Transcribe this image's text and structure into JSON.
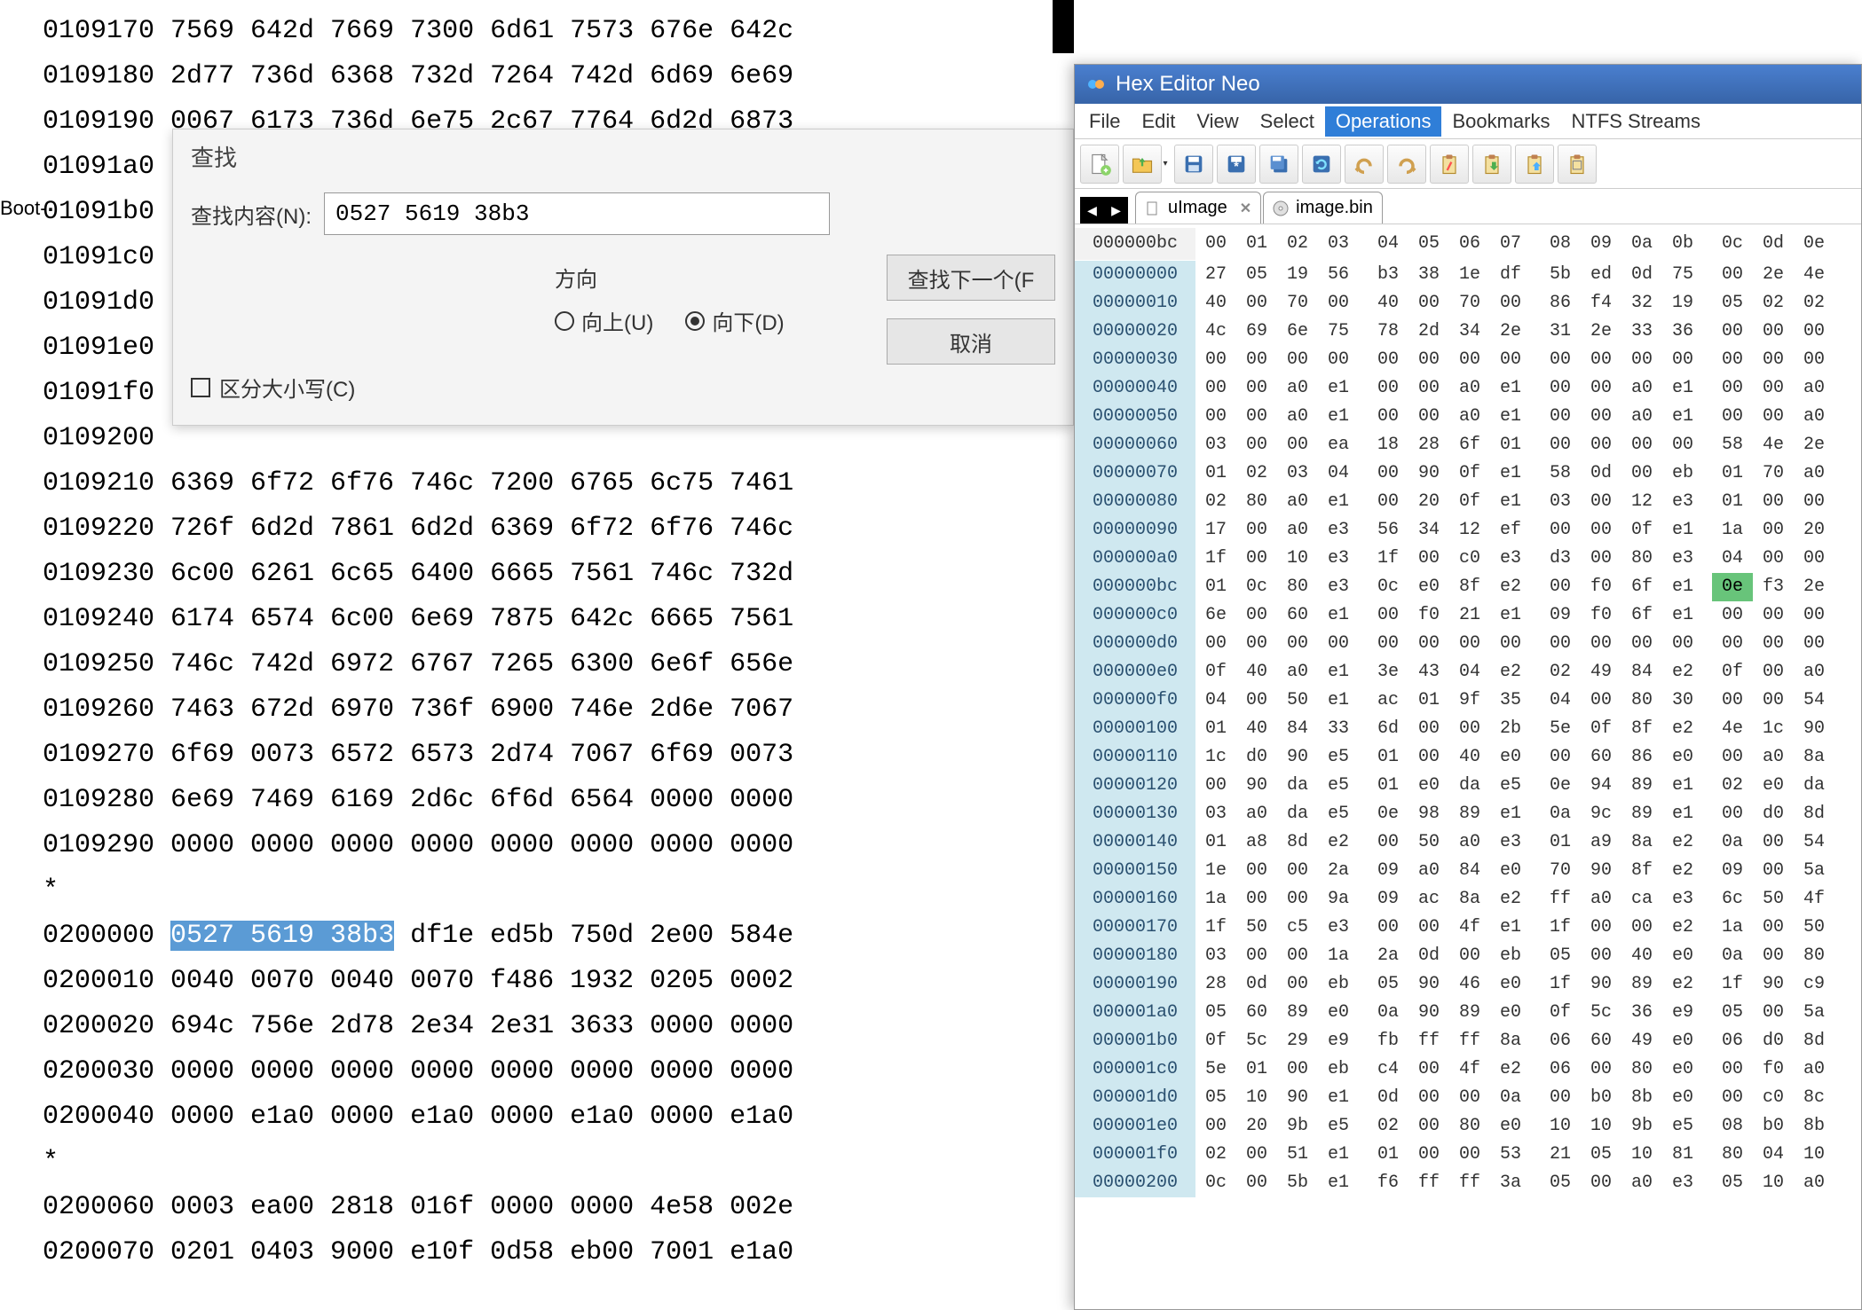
{
  "left": {
    "boot_label": "Boot-",
    "lines": [
      "0109170 7569 642d 7669 7300 6d61 7573 676e 642c",
      "0109180 2d77 736d 6368 732d 7264 742d 6d69 6e69",
      "0109190 0067 6173 736d 6e75 2c67 7764 6d2d 6873",
      "01091a0",
      "01091b0",
      "01091c0",
      "01091d0",
      "01091e0",
      "01091f0",
      "0109200",
      "0109210 6369 6f72 6f76 746c 7200 6765 6c75 7461",
      "0109220 726f 6d2d 7861 6d2d 6369 6f72 6f76 746c",
      "0109230 6c00 6261 6c65 6400 6665 7561 746c 732d",
      "0109240 6174 6574 6c00 6e69 7875 642c 6665 7561",
      "0109250 746c 742d 6972 6767 7265 6300 6e6f 656e",
      "0109260 7463 672d 6970 736f 6900 746e 2d6e 7067",
      "0109270 6f69 0073 6572 6573 2d74 7067 6f69 0073",
      "0109280 6e69 7469 6169 2d6c 6f6d 6564 0000 0000",
      "0109290 0000 0000 0000 0000 0000 0000 0000 0000",
      "*",
      "0200000 {HL}0527 5619 38b3{/HL} df1e ed5b 750d 2e00 584e",
      "0200010 0040 0070 0040 0070 f486 1932 0205 0002",
      "0200020 694c 756e 2d78 2e34 2e31 3633 0000 0000",
      "0200030 0000 0000 0000 0000 0000 0000 0000 0000",
      "0200040 0000 e1a0 0000 e1a0 0000 e1a0 0000 e1a0",
      "*",
      "0200060 0003 ea00 2818 016f 0000 0000 4e58 002e",
      "0200070 0201 0403 9000 e10f 0d58 eb00 7001 e1a0"
    ]
  },
  "find_dialog": {
    "title": "查找",
    "label": "查找内容(N):",
    "value": "0527 5619 38b3",
    "direction_label": "方向",
    "radio_up": "向上(U)",
    "radio_down": "向下(D)",
    "case_label": "区分大小写(C)",
    "btn_next": "查找下一个(F",
    "btn_cancel": "取消"
  },
  "hex_editor": {
    "title": "Hex Editor Neo",
    "menuitems": [
      "File",
      "Edit",
      "View",
      "Select",
      "Operations",
      "Bookmarks",
      "NTFS Streams"
    ],
    "active_menu": 4,
    "tabs": [
      {
        "label": "uImage",
        "closable": true
      },
      {
        "label": "image.bin",
        "closable": false
      }
    ],
    "header_addr": "000000bc",
    "columns": [
      "00",
      "01",
      "02",
      "03",
      "04",
      "05",
      "06",
      "07",
      "08",
      "09",
      "0a",
      "0b",
      "0c",
      "0d",
      "0e"
    ],
    "rows": [
      {
        "addr": "00000000",
        "b": [
          "27",
          "05",
          "19",
          "56",
          "b3",
          "38",
          "1e",
          "df",
          "5b",
          "ed",
          "0d",
          "75",
          "00",
          "2e",
          "4e"
        ]
      },
      {
        "addr": "00000010",
        "b": [
          "40",
          "00",
          "70",
          "00",
          "40",
          "00",
          "70",
          "00",
          "86",
          "f4",
          "32",
          "19",
          "05",
          "02",
          "02"
        ]
      },
      {
        "addr": "00000020",
        "b": [
          "4c",
          "69",
          "6e",
          "75",
          "78",
          "2d",
          "34",
          "2e",
          "31",
          "2e",
          "33",
          "36",
          "00",
          "00",
          "00"
        ]
      },
      {
        "addr": "00000030",
        "b": [
          "00",
          "00",
          "00",
          "00",
          "00",
          "00",
          "00",
          "00",
          "00",
          "00",
          "00",
          "00",
          "00",
          "00",
          "00"
        ]
      },
      {
        "addr": "00000040",
        "b": [
          "00",
          "00",
          "a0",
          "e1",
          "00",
          "00",
          "a0",
          "e1",
          "00",
          "00",
          "a0",
          "e1",
          "00",
          "00",
          "a0"
        ]
      },
      {
        "addr": "00000050",
        "b": [
          "00",
          "00",
          "a0",
          "e1",
          "00",
          "00",
          "a0",
          "e1",
          "00",
          "00",
          "a0",
          "e1",
          "00",
          "00",
          "a0"
        ]
      },
      {
        "addr": "00000060",
        "b": [
          "03",
          "00",
          "00",
          "ea",
          "18",
          "28",
          "6f",
          "01",
          "00",
          "00",
          "00",
          "00",
          "58",
          "4e",
          "2e"
        ]
      },
      {
        "addr": "00000070",
        "b": [
          "01",
          "02",
          "03",
          "04",
          "00",
          "90",
          "0f",
          "e1",
          "58",
          "0d",
          "00",
          "eb",
          "01",
          "70",
          "a0"
        ]
      },
      {
        "addr": "00000080",
        "b": [
          "02",
          "80",
          "a0",
          "e1",
          "00",
          "20",
          "0f",
          "e1",
          "03",
          "00",
          "12",
          "e3",
          "01",
          "00",
          "00"
        ]
      },
      {
        "addr": "00000090",
        "b": [
          "17",
          "00",
          "a0",
          "e3",
          "56",
          "34",
          "12",
          "ef",
          "00",
          "00",
          "0f",
          "e1",
          "1a",
          "00",
          "20"
        ]
      },
      {
        "addr": "000000a0",
        "b": [
          "1f",
          "00",
          "10",
          "e3",
          "1f",
          "00",
          "c0",
          "e3",
          "d3",
          "00",
          "80",
          "e3",
          "04",
          "00",
          "00"
        ]
      },
      {
        "addr": "000000bc",
        "b": [
          "01",
          "0c",
          "80",
          "e3",
          "0c",
          "e0",
          "8f",
          "e2",
          "00",
          "f0",
          "6f",
          "e1",
          "0e",
          "f3",
          "2e"
        ],
        "hi": 12
      },
      {
        "addr": "000000c0",
        "b": [
          "6e",
          "00",
          "60",
          "e1",
          "00",
          "f0",
          "21",
          "e1",
          "09",
          "f0",
          "6f",
          "e1",
          "00",
          "00",
          "00"
        ]
      },
      {
        "addr": "000000d0",
        "b": [
          "00",
          "00",
          "00",
          "00",
          "00",
          "00",
          "00",
          "00",
          "00",
          "00",
          "00",
          "00",
          "00",
          "00",
          "00"
        ]
      },
      {
        "addr": "000000e0",
        "b": [
          "0f",
          "40",
          "a0",
          "e1",
          "3e",
          "43",
          "04",
          "e2",
          "02",
          "49",
          "84",
          "e2",
          "0f",
          "00",
          "a0"
        ]
      },
      {
        "addr": "000000f0",
        "b": [
          "04",
          "00",
          "50",
          "e1",
          "ac",
          "01",
          "9f",
          "35",
          "04",
          "00",
          "80",
          "30",
          "00",
          "00",
          "54"
        ]
      },
      {
        "addr": "00000100",
        "b": [
          "01",
          "40",
          "84",
          "33",
          "6d",
          "00",
          "00",
          "2b",
          "5e",
          "0f",
          "8f",
          "e2",
          "4e",
          "1c",
          "90"
        ]
      },
      {
        "addr": "00000110",
        "b": [
          "1c",
          "d0",
          "90",
          "e5",
          "01",
          "00",
          "40",
          "e0",
          "00",
          "60",
          "86",
          "e0",
          "00",
          "a0",
          "8a"
        ]
      },
      {
        "addr": "00000120",
        "b": [
          "00",
          "90",
          "da",
          "e5",
          "01",
          "e0",
          "da",
          "e5",
          "0e",
          "94",
          "89",
          "e1",
          "02",
          "e0",
          "da"
        ]
      },
      {
        "addr": "00000130",
        "b": [
          "03",
          "a0",
          "da",
          "e5",
          "0e",
          "98",
          "89",
          "e1",
          "0a",
          "9c",
          "89",
          "e1",
          "00",
          "d0",
          "8d"
        ]
      },
      {
        "addr": "00000140",
        "b": [
          "01",
          "a8",
          "8d",
          "e2",
          "00",
          "50",
          "a0",
          "e3",
          "01",
          "a9",
          "8a",
          "e2",
          "0a",
          "00",
          "54"
        ]
      },
      {
        "addr": "00000150",
        "b": [
          "1e",
          "00",
          "00",
          "2a",
          "09",
          "a0",
          "84",
          "e0",
          "70",
          "90",
          "8f",
          "e2",
          "09",
          "00",
          "5a"
        ]
      },
      {
        "addr": "00000160",
        "b": [
          "1a",
          "00",
          "00",
          "9a",
          "09",
          "ac",
          "8a",
          "e2",
          "ff",
          "a0",
          "ca",
          "e3",
          "6c",
          "50",
          "4f"
        ]
      },
      {
        "addr": "00000170",
        "b": [
          "1f",
          "50",
          "c5",
          "e3",
          "00",
          "00",
          "4f",
          "e1",
          "1f",
          "00",
          "00",
          "e2",
          "1a",
          "00",
          "50"
        ]
      },
      {
        "addr": "00000180",
        "b": [
          "03",
          "00",
          "00",
          "1a",
          "2a",
          "0d",
          "00",
          "eb",
          "05",
          "00",
          "40",
          "e0",
          "0a",
          "00",
          "80"
        ]
      },
      {
        "addr": "00000190",
        "b": [
          "28",
          "0d",
          "00",
          "eb",
          "05",
          "90",
          "46",
          "e0",
          "1f",
          "90",
          "89",
          "e2",
          "1f",
          "90",
          "c9"
        ]
      },
      {
        "addr": "000001a0",
        "b": [
          "05",
          "60",
          "89",
          "e0",
          "0a",
          "90",
          "89",
          "e0",
          "0f",
          "5c",
          "36",
          "e9",
          "05",
          "00",
          "5a"
        ]
      },
      {
        "addr": "000001b0",
        "b": [
          "0f",
          "5c",
          "29",
          "e9",
          "fb",
          "ff",
          "ff",
          "8a",
          "06",
          "60",
          "49",
          "e0",
          "06",
          "d0",
          "8d"
        ]
      },
      {
        "addr": "000001c0",
        "b": [
          "5e",
          "01",
          "00",
          "eb",
          "c4",
          "00",
          "4f",
          "e2",
          "06",
          "00",
          "80",
          "e0",
          "00",
          "f0",
          "a0"
        ]
      },
      {
        "addr": "000001d0",
        "b": [
          "05",
          "10",
          "90",
          "e1",
          "0d",
          "00",
          "00",
          "0a",
          "00",
          "b0",
          "8b",
          "e0",
          "00",
          "c0",
          "8c"
        ]
      },
      {
        "addr": "000001e0",
        "b": [
          "00",
          "20",
          "9b",
          "e5",
          "02",
          "00",
          "80",
          "e0",
          "10",
          "10",
          "9b",
          "e5",
          "08",
          "b0",
          "8b"
        ]
      },
      {
        "addr": "000001f0",
        "b": [
          "02",
          "00",
          "51",
          "e1",
          "01",
          "00",
          "00",
          "53",
          "21",
          "05",
          "10",
          "81",
          "80",
          "04",
          "10"
        ]
      },
      {
        "addr": "00000200",
        "b": [
          "0c",
          "00",
          "5b",
          "e1",
          "f6",
          "ff",
          "ff",
          "3a",
          "05",
          "00",
          "a0",
          "e3",
          "05",
          "10",
          "a0"
        ]
      }
    ]
  }
}
